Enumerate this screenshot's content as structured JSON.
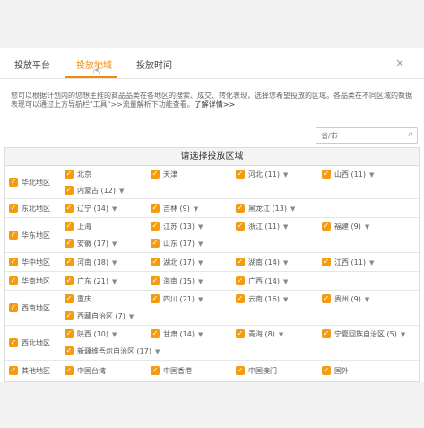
{
  "tabs": [
    {
      "label": "投放平台"
    },
    {
      "label": "投放地域"
    },
    {
      "label": "投放时间"
    }
  ],
  "close_label": "×",
  "description": "您可以根据计划内的您想主推的商品品类在各地区的搜索、成交、转化表现，选择您希望投放的区域。各品类在不同区域的数据表现可以通过上方导航栏\"工具\">>流量解析下功能查看。",
  "description_link": "了解详情>>",
  "search": {
    "placeholder": "省/市"
  },
  "region_title": "请选择投放区域",
  "regions": [
    {
      "name": "华北地区",
      "items": [
        {
          "label": "北京"
        },
        {
          "label": "天津"
        },
        {
          "label": "河北 (11)"
        },
        {
          "label": "山西 (11)"
        },
        {
          "label": "内蒙古 (12)"
        }
      ]
    },
    {
      "name": "东北地区",
      "items": [
        {
          "label": "辽宁 (14)"
        },
        {
          "label": "吉林 (9)"
        },
        {
          "label": "黑龙江 (13)"
        }
      ]
    },
    {
      "name": "华东地区",
      "items": [
        {
          "label": "上海"
        },
        {
          "label": "江苏 (13)"
        },
        {
          "label": "浙江 (11)"
        },
        {
          "label": "福建 (9)"
        },
        {
          "label": "安徽 (17)"
        },
        {
          "label": "山东 (17)"
        }
      ]
    },
    {
      "name": "华中地区",
      "items": [
        {
          "label": "河南 (18)"
        },
        {
          "label": "湖北 (17)"
        },
        {
          "label": "湖南 (14)"
        },
        {
          "label": "江西 (11)"
        }
      ]
    },
    {
      "name": "华南地区",
      "items": [
        {
          "label": "广东 (21)"
        },
        {
          "label": "海南 (15)"
        },
        {
          "label": "广西 (14)"
        }
      ]
    },
    {
      "name": "西南地区",
      "items": [
        {
          "label": "重庆"
        },
        {
          "label": "四川 (21)"
        },
        {
          "label": "云南 (16)"
        },
        {
          "label": "贵州 (9)"
        },
        {
          "label": "西藏自治区 (7)"
        }
      ]
    },
    {
      "name": "西北地区",
      "items": [
        {
          "label": "陕西 (10)"
        },
        {
          "label": "甘肃 (14)"
        },
        {
          "label": "青海 (8)"
        },
        {
          "label": "宁夏回族自治区 (5)"
        },
        {
          "label": "新疆维吾尔自治区 (17)"
        }
      ]
    },
    {
      "name": "其他地区",
      "items": [
        {
          "label": "中国台湾"
        },
        {
          "label": "中国香港"
        },
        {
          "label": "中国澳门"
        },
        {
          "label": "国外"
        }
      ]
    }
  ],
  "colors": {
    "accent": "#f08c00",
    "checkbox": "#f39c12"
  },
  "icons": {
    "search": "magnifier-icon",
    "close": "close-icon",
    "dropdown": "caret-down-icon",
    "checkbox": "checkbox-checked-icon"
  }
}
